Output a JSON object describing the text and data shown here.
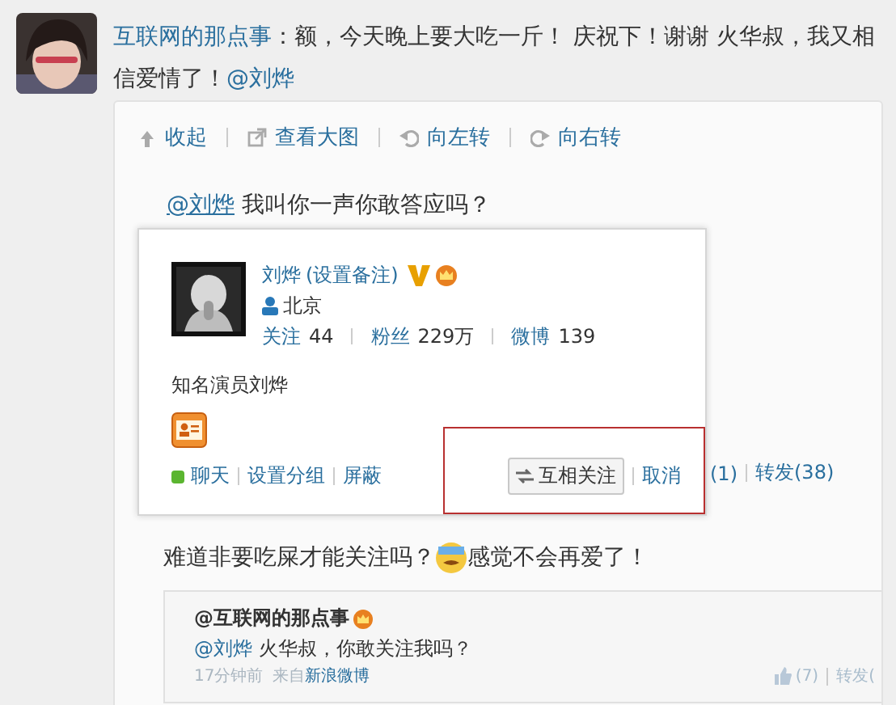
{
  "post": {
    "author": "互联网的那点事",
    "text": "：额，今天晚上要大吃一斤！ 庆祝下！谢谢 火华叔，我又相信爱情了！",
    "mention": "@刘烨"
  },
  "toolbar": [
    {
      "kind": "collapse",
      "label": "收起"
    },
    {
      "kind": "view",
      "label": "查看大图"
    },
    {
      "kind": "rotate_left",
      "label": "向左转"
    },
    {
      "kind": "rotate_right",
      "label": "向右转"
    }
  ],
  "image": {
    "mention": "@刘烨",
    "text": "我叫你一声你敢答应吗？",
    "popup": {
      "name": "刘烨",
      "remark": "(设置备注)",
      "verified": true,
      "location": "北京",
      "stats": [
        {
          "label": "关注",
          "value": "44"
        },
        {
          "label": "粉丝",
          "value": "229万"
        },
        {
          "label": "微博",
          "value": "139"
        }
      ],
      "bio": "知名演员刘烨",
      "actions": [
        {
          "label": "聊天",
          "online": true
        },
        {
          "label": "设置分组",
          "online": false
        },
        {
          "label": "屏蔽",
          "online": false
        }
      ],
      "follow": {
        "label": "互相关注",
        "cancel": "取消"
      }
    },
    "counts": [
      "(1)",
      "转发(38)"
    ],
    "comment": {
      "before": "难道非要吃屎才能关注吗？",
      "after": "感觉不会再爱了！"
    },
    "quote": {
      "author": "@互联网的那点事",
      "mention": "@刘烨",
      "text": "火华叔，你敢关注我吗？",
      "time": "17分钟前",
      "source_prefix": "来自",
      "source": "新浪微博",
      "counts": [
        "(7)",
        "转发("
      ]
    }
  }
}
